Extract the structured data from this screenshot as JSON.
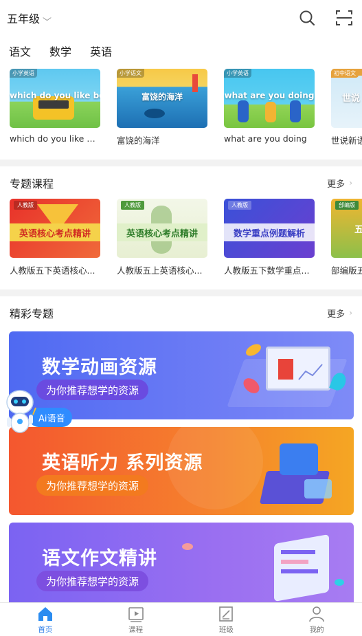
{
  "header": {
    "grade": "五年级"
  },
  "tabs": [
    "语文",
    "数学",
    "英语"
  ],
  "lessons": [
    {
      "tag": "小学英语",
      "thumb_title": "which do you like better",
      "caption": "which do you like better"
    },
    {
      "tag": "小学语文",
      "thumb_title": "富饶的海洋",
      "caption": "富饶的海洋"
    },
    {
      "tag": "小学英语",
      "thumb_title": "what are you doing",
      "caption": "what are you doing"
    },
    {
      "tag": "初中语文",
      "thumb_title": "世说",
      "caption": "世说新语"
    }
  ],
  "special": {
    "title": "专题课程",
    "more": "更多",
    "items": [
      {
        "tag": "人教版",
        "band": "英语核心考点精讲",
        "caption": "人教版五下英语核心..."
      },
      {
        "tag": "人教版",
        "band": "英语核心考点精讲",
        "caption": "人教版五上英语核心..."
      },
      {
        "tag": "人教版",
        "band": "数学重点例题解析",
        "caption": "人教版五下数学重点..."
      },
      {
        "tag": "部编版",
        "band": "五",
        "caption": "部编版五"
      }
    ]
  },
  "featured": {
    "title": "精彩专题",
    "more": "更多",
    "banners": [
      {
        "title": "数学动画资源",
        "subtitle": "为你推荐想学的资源"
      },
      {
        "title": "英语听力 系列资源",
        "subtitle": "为你推荐想学的资源"
      },
      {
        "title": "语文作文精讲",
        "subtitle": "为你推荐想学的资源"
      }
    ]
  },
  "ai": {
    "label": "Ai语音"
  },
  "nav": [
    {
      "label": "首页",
      "active": true
    },
    {
      "label": "课程",
      "active": false
    },
    {
      "label": "班级",
      "active": false
    },
    {
      "label": "我的",
      "active": false
    }
  ],
  "colors": {
    "accent": "#2b7de9",
    "divider": "#f2f2f2"
  }
}
